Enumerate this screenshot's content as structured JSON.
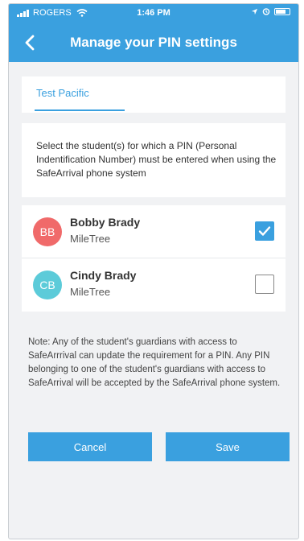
{
  "status_bar": {
    "carrier": "ROGERS",
    "time": "1:46 PM"
  },
  "header": {
    "title": "Manage your PIN settings",
    "back_icon": "chevron-left-icon"
  },
  "tabs": [
    {
      "label": "Test Pacific",
      "selected": true
    }
  ],
  "description": "Select the student(s) for which a PIN (Personal Indentification Number) must be entered when using the SafeArrival phone system",
  "students": [
    {
      "initials": "BB",
      "name": "Bobby Brady",
      "school": "MileTree",
      "avatar_color": "#f06a6a",
      "checked": true
    },
    {
      "initials": "CB",
      "name": "Cindy Brady",
      "school": "MileTree",
      "avatar_color": "#5ccbd9",
      "checked": false
    }
  ],
  "note": "Note: Any of the student's guardians with access to SafeArrrival can update the requirement for a PIN. Any PIN belonging to one of the student's guardians with access to SafeArrival will be accepted by the SafeArrival phone system.",
  "buttons": {
    "cancel_label": "Cancel",
    "save_label": "Save"
  },
  "colors": {
    "accent": "#3aa0df",
    "background": "#f1f2f4"
  }
}
